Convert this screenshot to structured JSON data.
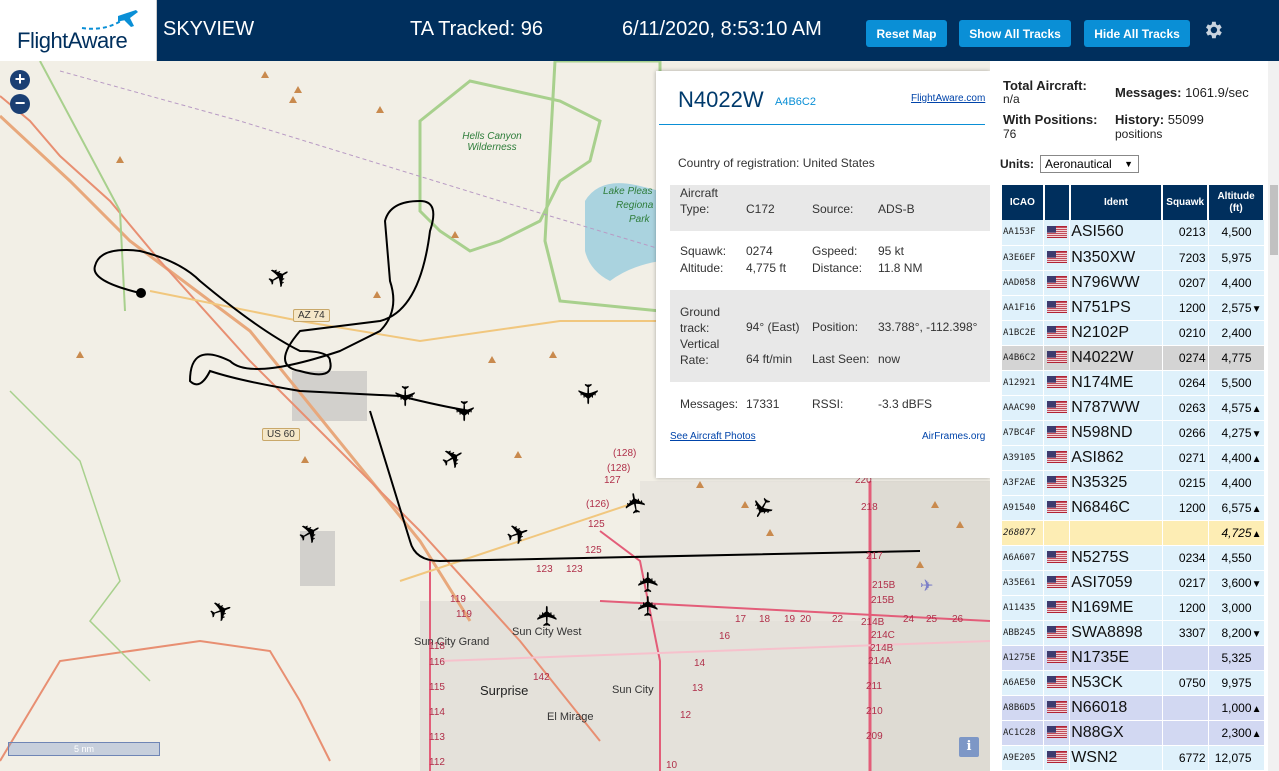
{
  "header": {
    "logo": "FlightAware",
    "app_title": "SKYVIEW",
    "ta_tracked": "TA Tracked: 96",
    "datetime": "6/11/2020, 8:53:10 AM",
    "btn_reset": "Reset Map",
    "btn_show": "Show All Tracks",
    "btn_hide": "Hide All Tracks",
    "settings_icon": "gear-icon"
  },
  "map": {
    "zoom_in": "+",
    "zoom_out": "−",
    "scale": "5 nm",
    "info": "i",
    "labels": {
      "wilderness": "Hells Canyon\nWilderness",
      "lake": "Lake Pleas",
      "lake2": "Regiona",
      "lake3": "Park",
      "az74": "AZ 74",
      "us60": "US 60",
      "sun_city_grand": "Sun City Grand",
      "sun_city_west": "Sun City West",
      "surprise": "Surprise",
      "sun_city": "Sun City",
      "el_mirage": "El Mirage"
    },
    "road_numbers": [
      "(128)",
      "(128)",
      "127",
      "(126)",
      "125",
      "125",
      "123",
      "123",
      "119",
      "119",
      "118",
      "116",
      "115",
      "114",
      "113",
      "112",
      "142",
      "220",
      "218",
      "217",
      "215B",
      "215B",
      "214B",
      "214C",
      "214B",
      "214A",
      "211",
      "210",
      "209",
      "24",
      "25",
      "26",
      "22",
      "20",
      "19",
      "18",
      "17",
      "16",
      "14",
      "13",
      "12",
      "10"
    ]
  },
  "aircraft_popup": {
    "ident": "N4022W",
    "icao": "A4B6C2",
    "fa_link": "FlightAware.com",
    "country_label": "Country of registration:",
    "country": "United States",
    "aircraft_type_label": "Aircraft\nType:",
    "aircraft_type": "C172",
    "source_label": "Source:",
    "source": "ADS-B",
    "squawk_label": "Squawk:",
    "squawk": "0274",
    "gspeed_label": "Gspeed:",
    "gspeed": "95 kt",
    "altitude_label": "Altitude:",
    "altitude": "4,775 ft",
    "distance_label": "Distance:",
    "distance": "11.8 NM",
    "ground_track_label": "Ground\ntrack:",
    "ground_track": "94° (East)",
    "position_label": "Position:",
    "position": "33.788°, -112.398°",
    "vrate_label": "Vertical\nRate:",
    "vrate": "64 ft/min",
    "last_seen_label": "Last Seen:",
    "last_seen": "now",
    "messages_label": "Messages:",
    "messages": "17331",
    "rssi_label": "RSSI:",
    "rssi": "-3.3 dBFS",
    "photos_link": "See Aircraft Photos",
    "airframes_link": "AirFrames.org"
  },
  "sidebar": {
    "total_label": "Total Aircraft:",
    "total_value": "n/a",
    "messages_label": "Messages:",
    "messages_value": "1061.9/sec",
    "positions_label": "With Positions:",
    "positions_value": "76",
    "history_label": "History:",
    "history_value": "55099",
    "history_unit": "positions",
    "units_label": "Units:",
    "units_value": "Aeronautical",
    "columns": [
      "ICAO",
      "",
      "Ident",
      "Squawk",
      "Altitude\n(ft)"
    ],
    "rows": [
      {
        "icao": "AA153F",
        "flag": true,
        "ident": "ASI560",
        "squawk": "0213",
        "alt": "4,500",
        "trend": "",
        "style": "blue"
      },
      {
        "icao": "A3E6EF",
        "flag": true,
        "ident": "N350XW",
        "squawk": "7203",
        "alt": "5,975",
        "trend": "",
        "style": "blue"
      },
      {
        "icao": "AAD058",
        "flag": true,
        "ident": "N796WW",
        "squawk": "0207",
        "alt": "4,400",
        "trend": "",
        "style": "blue"
      },
      {
        "icao": "AA1F16",
        "flag": true,
        "ident": "N751PS",
        "squawk": "1200",
        "alt": "2,575",
        "trend": "▼",
        "style": "blue"
      },
      {
        "icao": "A1BC2E",
        "flag": true,
        "ident": "N2102P",
        "squawk": "0210",
        "alt": "2,400",
        "trend": "",
        "style": "blue"
      },
      {
        "icao": "A4B6C2",
        "flag": true,
        "ident": "N4022W",
        "squawk": "0274",
        "alt": "4,775",
        "trend": "",
        "style": "sel"
      },
      {
        "icao": "A12921",
        "flag": true,
        "ident": "N174ME",
        "squawk": "0264",
        "alt": "5,500",
        "trend": "",
        "style": "blue"
      },
      {
        "icao": "AAAC90",
        "flag": true,
        "ident": "N787WW",
        "squawk": "0263",
        "alt": "4,575",
        "trend": "▲",
        "style": "blue"
      },
      {
        "icao": "A7BC4F",
        "flag": true,
        "ident": "N598ND",
        "squawk": "0266",
        "alt": "4,275",
        "trend": "▼",
        "style": "blue"
      },
      {
        "icao": "A39105",
        "flag": true,
        "ident": "ASI862",
        "squawk": "0271",
        "alt": "4,400",
        "trend": "▲",
        "style": "blue"
      },
      {
        "icao": "A3F2AE",
        "flag": true,
        "ident": "N35325",
        "squawk": "0215",
        "alt": "4,400",
        "trend": "",
        "style": "blue"
      },
      {
        "icao": "A91540",
        "flag": true,
        "ident": "N6846C",
        "squawk": "1200",
        "alt": "6,575",
        "trend": "▲",
        "style": "blue"
      },
      {
        "icao": "268077",
        "flag": false,
        "ident": "",
        "squawk": "",
        "alt": "4,725",
        "trend": "▲",
        "style": "yellow"
      },
      {
        "icao": "A6A607",
        "flag": true,
        "ident": "N5275S",
        "squawk": "0234",
        "alt": "4,550",
        "trend": "",
        "style": "blue"
      },
      {
        "icao": "A35E61",
        "flag": true,
        "ident": "ASI7059",
        "squawk": "0217",
        "alt": "3,600",
        "trend": "▼",
        "style": "blue"
      },
      {
        "icao": "A11435",
        "flag": true,
        "ident": "N169ME",
        "squawk": "1200",
        "alt": "3,000",
        "trend": "",
        "style": "blue"
      },
      {
        "icao": "ABB245",
        "flag": true,
        "ident": "SWA8898",
        "squawk": "3307",
        "alt": "8,200",
        "trend": "▼",
        "style": "blue"
      },
      {
        "icao": "A1275E",
        "flag": true,
        "ident": "N1735E",
        "squawk": "",
        "alt": "5,325",
        "trend": "",
        "style": "lav"
      },
      {
        "icao": "A6AE50",
        "flag": true,
        "ident": "N53CK",
        "squawk": "0750",
        "alt": "9,975",
        "trend": "",
        "style": "blue"
      },
      {
        "icao": "A8B6D5",
        "flag": true,
        "ident": "N66018",
        "squawk": "",
        "alt": "1,000",
        "trend": "▲",
        "style": "lav"
      },
      {
        "icao": "AC1C28",
        "flag": true,
        "ident": "N88GX",
        "squawk": "",
        "alt": "2,300",
        "trend": "▲",
        "style": "lav"
      },
      {
        "icao": "A9E205",
        "flag": true,
        "ident": "WSN2",
        "squawk": "6772",
        "alt": "12,075",
        "trend": "",
        "style": "blue"
      }
    ]
  },
  "colors": {
    "header_bg": "#002f5d",
    "button_bg": "#0a8fd6",
    "row_blue": "#dff1fb",
    "row_selected": "#d4d4d4",
    "row_yellow": "#fdedb4",
    "row_lavender": "#d2d8f2"
  }
}
